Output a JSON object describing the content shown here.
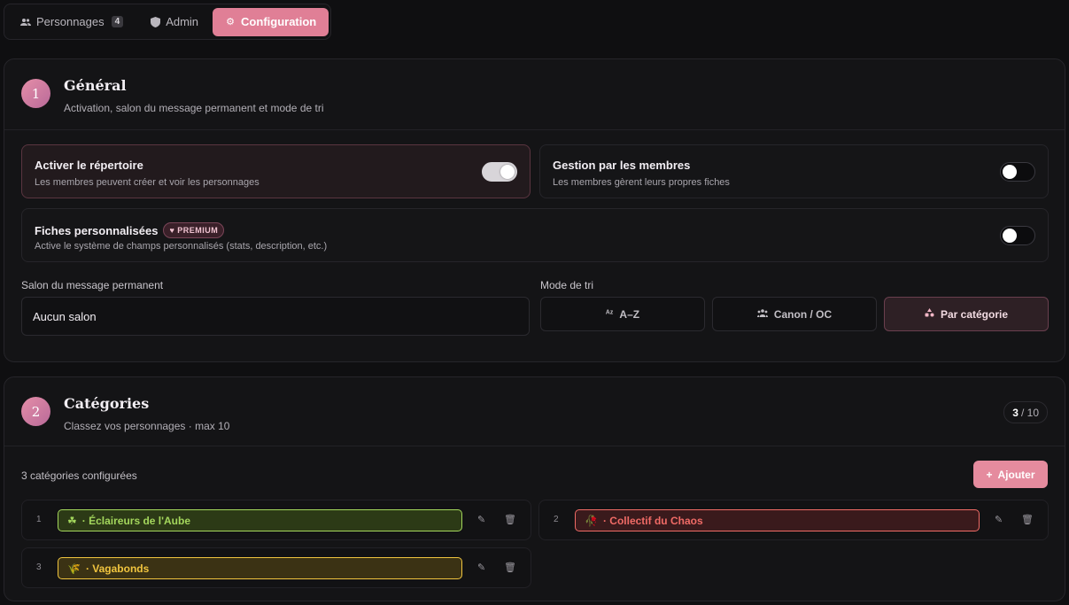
{
  "tabs": [
    {
      "label": "Personnages",
      "count": "4",
      "icon": "users-icon"
    },
    {
      "label": "Admin",
      "icon": "shield-icon"
    },
    {
      "label": "Configuration",
      "icon": "gear-icon"
    }
  ],
  "general": {
    "number": "1",
    "title": "Général",
    "subtitle": "Activation, salon du message permanent et mode de tri",
    "options": [
      {
        "title": "Activer le répertoire",
        "desc": "Les membres peuvent créer et voir les personnages",
        "enabled": true
      },
      {
        "title": "Gestion par les membres",
        "desc": "Les membres gèrent leurs propres fiches",
        "enabled": false
      },
      {
        "title": "Fiches personnalisées",
        "badge": "PREMIUM",
        "desc": "Active le système de champs personnalisés (stats, description, etc.)",
        "enabled": false
      }
    ],
    "salon_label": "Salon du message permanent",
    "salon_value": "Aucun salon",
    "sort_label": "Mode de tri",
    "sort_options": [
      {
        "label": "A–Z",
        "icon": "sort-alpha-icon"
      },
      {
        "label": "Canon / OC",
        "icon": "group-icon"
      },
      {
        "label": "Par catégorie",
        "icon": "category-icon",
        "selected": true
      }
    ]
  },
  "categories": {
    "number": "2",
    "title": "Catégories",
    "subtitle": "Classez vos personnages · max 10",
    "counter_current": "3",
    "counter_max": "/ 10",
    "configured_text": "3 catégories configurées",
    "add_label": "Ajouter",
    "items": [
      {
        "index": "1",
        "emoji": "☘",
        "name": "· Éclaireurs de l'Aube",
        "color": "#8bc34a"
      },
      {
        "index": "2",
        "emoji": "🥀",
        "name": "· Collectif du Chaos",
        "color": "#e0534f"
      },
      {
        "index": "3",
        "emoji": "🌾",
        "name": "· Vagabonds",
        "color": "#e9b82e"
      }
    ]
  },
  "colors": {
    "accent": "#e07f96",
    "background": "#0f0f11"
  }
}
